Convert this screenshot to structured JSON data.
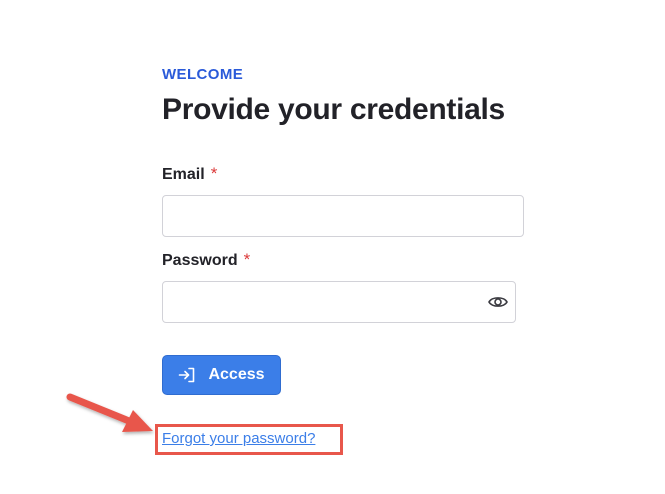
{
  "header": {
    "eyebrow": "WELCOME",
    "title": "Provide your credentials"
  },
  "form": {
    "email": {
      "label": "Email",
      "required_mark": "*",
      "value": "",
      "placeholder": ""
    },
    "password": {
      "label": "Password",
      "required_mark": "*",
      "value": "",
      "placeholder": "",
      "toggle_icon": "eye-icon"
    },
    "submit": {
      "label": "Access",
      "icon": "login-icon"
    },
    "forgot_link": "Forgot your password?"
  },
  "annotation": {
    "highlight_color": "#e8574b",
    "arrow_color": "#e8574b"
  },
  "colors": {
    "accent": "#3b7ee8",
    "eyebrow": "#2a5ad9",
    "required": "#dc3a3a"
  }
}
